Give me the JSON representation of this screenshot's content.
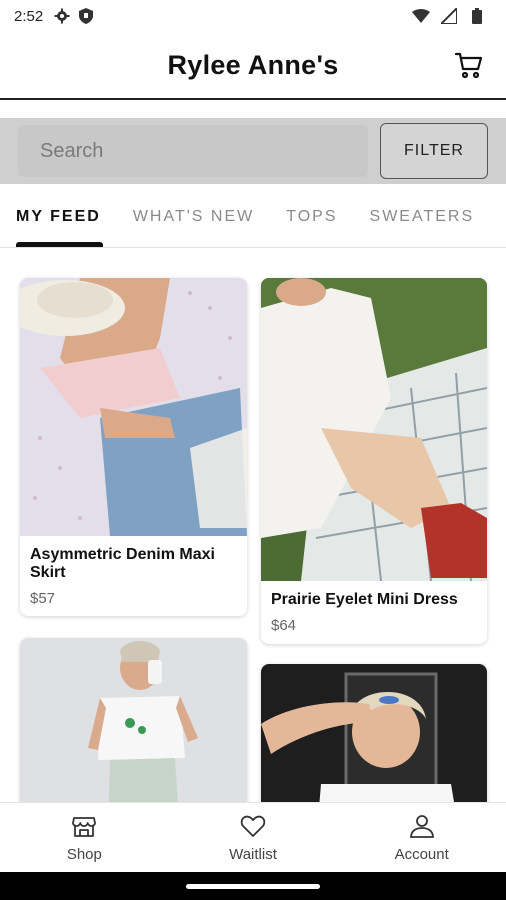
{
  "status_bar": {
    "time": "2:52"
  },
  "header": {
    "title": "Rylee Anne's"
  },
  "search": {
    "placeholder": "Search",
    "filter_label": "FILTER"
  },
  "tabs": [
    {
      "label": "MY FEED",
      "active": true
    },
    {
      "label": "WHAT'S NEW",
      "active": false
    },
    {
      "label": "TOPS",
      "active": false
    },
    {
      "label": "SWEATERS",
      "active": false
    }
  ],
  "products": [
    {
      "name": "Asymmetric Denim Maxi Skirt",
      "price": "$57"
    },
    {
      "name": "Prairie Eyelet Mini Dress",
      "price": "$64"
    },
    {
      "name": "",
      "price": ""
    },
    {
      "name": "",
      "price": ""
    }
  ],
  "bottom_nav": [
    {
      "label": "Shop",
      "icon": "shop-icon"
    },
    {
      "label": "Waitlist",
      "icon": "heart-icon"
    },
    {
      "label": "Account",
      "icon": "account-icon"
    }
  ]
}
